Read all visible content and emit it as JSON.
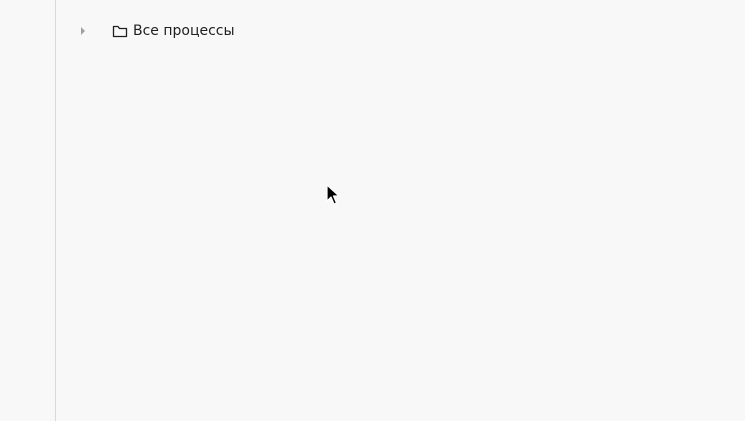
{
  "tree": {
    "nodes": [
      {
        "label": "Все процессы",
        "expander_icon": "caret-right-icon",
        "icon": "folder-icon",
        "expanded": false
      }
    ]
  },
  "colors": {
    "background": "#f8f8f8",
    "divider": "#d9d9d9",
    "text": "#1f1f1f",
    "expander": "#a0a0a0"
  }
}
